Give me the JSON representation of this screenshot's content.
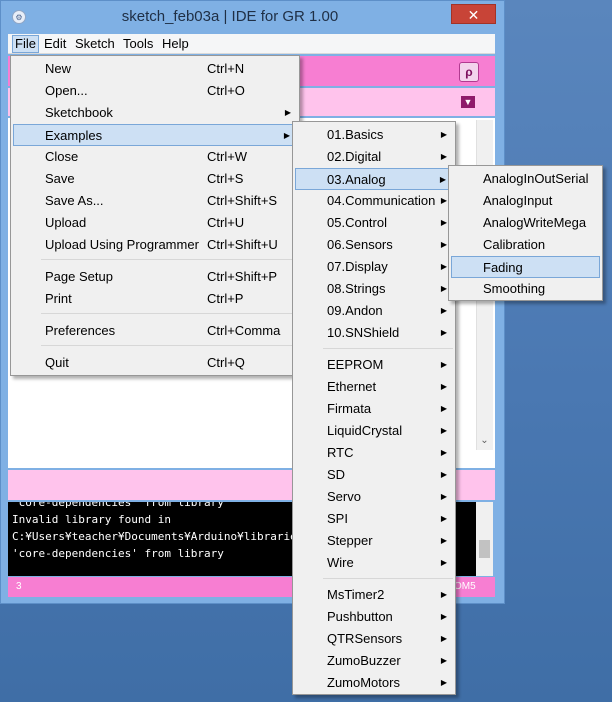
{
  "window": {
    "title": "sketch_feb03a | IDE for GR 1.00",
    "close_glyph": "✕",
    "app_icon": "gear-icon"
  },
  "menubar": {
    "items": [
      "File",
      "Edit",
      "Sketch",
      "Tools",
      "Help"
    ]
  },
  "file_menu": {
    "items": [
      {
        "label": "New",
        "shortcut": "Ctrl+N"
      },
      {
        "label": "Open...",
        "shortcut": "Ctrl+O"
      },
      {
        "label": "Sketchbook",
        "submenu": true
      },
      {
        "label": "Examples",
        "submenu": true,
        "highlighted": true
      },
      {
        "label": "Close",
        "shortcut": "Ctrl+W"
      },
      {
        "label": "Save",
        "shortcut": "Ctrl+S"
      },
      {
        "label": "Save As...",
        "shortcut": "Ctrl+Shift+S"
      },
      {
        "label": "Upload",
        "shortcut": "Ctrl+U"
      },
      {
        "label": "Upload Using Programmer",
        "shortcut": "Ctrl+Shift+U"
      },
      {
        "label": "Page Setup",
        "shortcut": "Ctrl+Shift+P"
      },
      {
        "label": "Print",
        "shortcut": "Ctrl+P"
      },
      {
        "label": "Preferences",
        "shortcut": "Ctrl+Comma"
      },
      {
        "label": "Quit",
        "shortcut": "Ctrl+Q"
      }
    ]
  },
  "examples_menu": {
    "items": [
      "01.Basics",
      "02.Digital",
      "03.Analog",
      "04.Communication",
      "05.Control",
      "06.Sensors",
      "07.Display",
      "08.Strings",
      "09.Andon",
      "10.SNShield",
      "EEPROM",
      "Ethernet",
      "Firmata",
      "LiquidCrystal",
      "RTC",
      "SD",
      "Servo",
      "SPI",
      "Stepper",
      "Wire",
      "MsTimer2",
      "Pushbutton",
      "QTRSensors",
      "ZumoBuzzer",
      "ZumoMotors"
    ],
    "highlighted": "03.Analog"
  },
  "analog_menu": {
    "items": [
      "AnalogInOutSerial",
      "AnalogInput",
      "AnalogWriteMega",
      "Calibration",
      "Fading",
      "Smoothing"
    ],
    "highlighted": "Fading"
  },
  "console": {
    "lines": [
      "'core-dependencies' from library",
      "Invalid library found in",
      "C:¥Users¥teacher¥Documents¥Arduino¥libraries¥Le",
      "'core-dependencies' from library"
    ]
  },
  "statusbar": {
    "line_number": "3",
    "port_suffix": "OM5"
  },
  "icons": {
    "serial_monitor": "serial-monitor-icon",
    "tab_menu": "chevron-down-icon",
    "submenu_arrow": "chevron-right-icon"
  },
  "colors": {
    "toolbar": "#f77ed2",
    "tabs": "#ffc3ec",
    "highlight": "#cde0f4",
    "close": "#c84437"
  }
}
